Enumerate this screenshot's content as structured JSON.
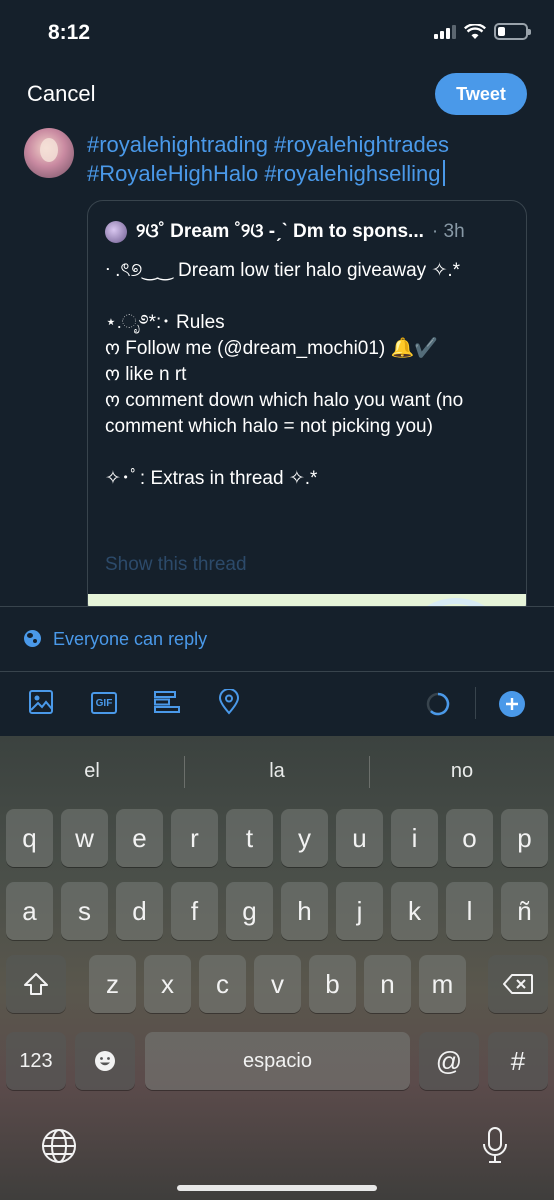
{
  "status_bar": {
    "time": "8:12"
  },
  "header": {
    "cancel_label": "Cancel",
    "tweet_label": "Tweet"
  },
  "compose": {
    "text": "#royalehightrading #royalehightrades #RoyaleHighHalo #royalehighselling"
  },
  "quoted_tweet": {
    "author": "୨ଓ˚ Dream ˚୨ଓ -ˏˋ Dm to spons...",
    "time": "· 3h",
    "lines": [
      "ᐧ .ৎ୭‿‿ Dream low tier halo giveaway ✧.*",
      "",
      "⋆.ೃ࿔*:･ Rules",
      "ო Follow me (@dream_mochi01) 🔔✔️",
      "ო like n rt",
      "ო comment down which halo you want (no comment which halo = not picking you)",
      "",
      "✧･ﾟ: Extras in thread ✧.*"
    ],
    "show_thread": "Show this thread"
  },
  "reply_setting": {
    "label": "Everyone can reply",
    "icon": "globe-icon"
  },
  "toolbar": {
    "items": [
      "image-icon",
      "gif-icon",
      "poll-icon",
      "location-icon",
      "character-counter",
      "add-icon"
    ],
    "gif_label": "GIF",
    "accent": "#4a99e9"
  },
  "keyboard": {
    "suggestions": [
      "el",
      "la",
      "no"
    ],
    "row1": [
      "q",
      "w",
      "e",
      "r",
      "t",
      "y",
      "u",
      "i",
      "o",
      "p"
    ],
    "row2": [
      "a",
      "s",
      "d",
      "f",
      "g",
      "h",
      "j",
      "k",
      "l",
      "ñ"
    ],
    "row3": [
      "z",
      "x",
      "c",
      "v",
      "b",
      "n",
      "m"
    ],
    "numbers_label": "123",
    "space_label": "espacio",
    "at_label": "@",
    "hash_label": "#"
  }
}
